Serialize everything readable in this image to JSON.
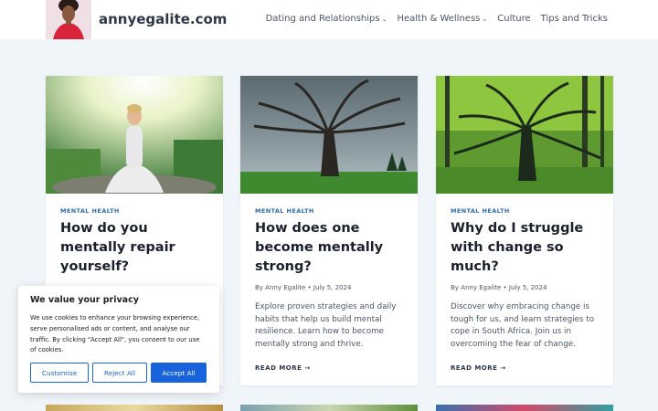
{
  "site": {
    "title": "annyegalite.com"
  },
  "nav": [
    {
      "label": "Dating and Relationships",
      "dropdown": true
    },
    {
      "label": "Health & Wellness",
      "dropdown": true
    },
    {
      "label": "Culture",
      "dropdown": false
    },
    {
      "label": "Tips and Tricks",
      "dropdown": false
    }
  ],
  "posts": [
    {
      "category": "MENTAL HEALTH",
      "title": "How do you mentally repair yourself?",
      "author": "",
      "date": "",
      "excerpt": "",
      "read_more": ""
    },
    {
      "category": "MENTAL HEALTH",
      "title": "How does one become mentally strong?",
      "author": "By Anny Egalite",
      "date": "July 5, 2024",
      "excerpt": "Explore proven strategies and daily habits that help us build mental resilience. Learn how to become mentally strong and thrive.",
      "read_more": "READ MORE →"
    },
    {
      "category": "MENTAL HEALTH",
      "title": "Why do I struggle with change so much?",
      "author": "By Anny Egalite",
      "date": "July 5, 2024",
      "excerpt": "Discover why embracing change is tough for us, and learn strategies to cope in South Africa. Join us in overcoming the fear of change.",
      "read_more": "READ MORE →"
    }
  ],
  "cookie": {
    "title": "We value your privacy",
    "text": "We use cookies to enhance your browsing experience, serve personalised ads or content, and analyse our traffic. By clicking \"Accept All\", you consent to our use of cookies.",
    "customise": "Customise",
    "reject": "Reject All",
    "accept": "Accept All"
  },
  "colors": {
    "page_bg": "#f0f5fa",
    "category": "#2b6cb0",
    "cookie_button": "#1863dc"
  }
}
